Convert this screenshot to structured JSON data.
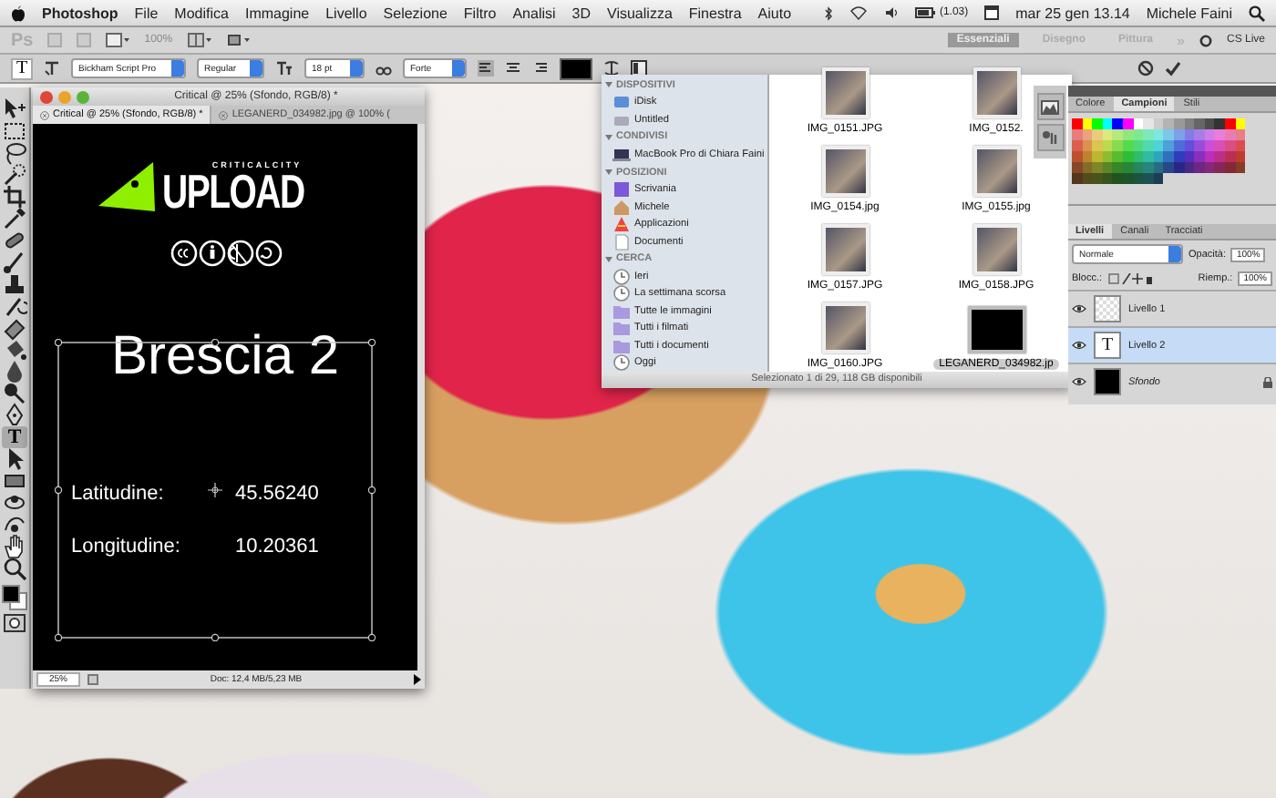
{
  "menubar": {
    "app": "Photoshop",
    "menus": [
      "File",
      "Modifica",
      "Immagine",
      "Livello",
      "Selezione",
      "Filtro",
      "Analisi",
      "3D",
      "Visualizza",
      "Finestra",
      "Aiuto"
    ],
    "battery": "(1.03)",
    "clock": "mar 25 gen 13.14",
    "user": "Michele Faini"
  },
  "app_bar": {
    "logo": "Ps",
    "zoom": "100%",
    "workspaces": [
      {
        "label": "Essenziali",
        "selected": true
      },
      {
        "label": "Disegno",
        "selected": false
      },
      {
        "label": "Pittura",
        "selected": false
      }
    ],
    "more": "»",
    "cs_live": "CS Live"
  },
  "options_bar": {
    "tool_glyph": "T",
    "font_family": "Bickham Script Pro",
    "font_style": "Regular",
    "font_size": "18 pt",
    "antialias": "Forte"
  },
  "tools": [
    {
      "kind": "move",
      "selected": false
    },
    {
      "kind": "marquee",
      "selected": false
    },
    {
      "kind": "lasso",
      "selected": false
    },
    {
      "kind": "quickselect",
      "selected": false
    },
    {
      "kind": "crop",
      "selected": false
    },
    {
      "kind": "eyedropper",
      "selected": false
    },
    {
      "kind": "heal",
      "selected": false
    },
    {
      "kind": "brush",
      "selected": false
    },
    {
      "kind": "stamp",
      "selected": false
    },
    {
      "kind": "history",
      "selected": false
    },
    {
      "kind": "eraser",
      "selected": false
    },
    {
      "kind": "bucket",
      "selected": false
    },
    {
      "kind": "blur",
      "selected": false
    },
    {
      "kind": "dodge",
      "selected": false
    },
    {
      "kind": "pen",
      "selected": false
    },
    {
      "kind": "type",
      "glyph": "T",
      "selected": true
    },
    {
      "kind": "pathselect",
      "selected": false
    },
    {
      "kind": "rectangle",
      "selected": false
    },
    {
      "kind": "rotate3d",
      "selected": false
    },
    {
      "kind": "orbit3d",
      "selected": false
    },
    {
      "kind": "hand",
      "selected": false
    },
    {
      "kind": "zoom",
      "selected": false
    }
  ],
  "document": {
    "title": "Critical @ 25% (Sfondo, RGB/8) *",
    "tabs": [
      {
        "label": "Critical @ 25% (Sfondo, RGB/8) *",
        "selected": true
      },
      {
        "label": "LEGANERD_034982.jpg @ 100% (",
        "selected": false
      }
    ],
    "canvas": {
      "logo_small": "CRITICALCITY",
      "logo_big": "UPLOAD",
      "heading": "Brescia 2",
      "fields": [
        {
          "label": "Latitudine:",
          "value": "45.56240"
        },
        {
          "label": "Longitudine:",
          "value": "10.20361"
        }
      ]
    },
    "zoom": "25%",
    "doc_info": "Doc: 12,4 MB/5,23 MB"
  },
  "finder": {
    "sections": [
      {
        "heading": "DISPOSITIVI",
        "items": [
          {
            "label": "iDisk",
            "kind": "disk"
          },
          {
            "label": "Untitled",
            "kind": "drive"
          }
        ]
      },
      {
        "heading": "CONDIVISI",
        "items": [
          {
            "label": "MacBook Pro di Chiara Faini",
            "kind": "computer"
          }
        ]
      },
      {
        "heading": "POSIZIONI",
        "items": [
          {
            "label": "Scrivania",
            "kind": "desktop"
          },
          {
            "label": "Michele",
            "kind": "home"
          },
          {
            "label": "Applicazioni",
            "kind": "apps"
          },
          {
            "label": "Documenti",
            "kind": "docs"
          }
        ]
      },
      {
        "heading": "CERCA",
        "items": [
          {
            "label": "Ieri",
            "kind": "clock"
          },
          {
            "label": "La settimana scorsa",
            "kind": "clock"
          },
          {
            "label": "Tutte le immagini",
            "kind": "folder"
          },
          {
            "label": "Tutti i filmati",
            "kind": "folder"
          },
          {
            "label": "Tutti i documenti",
            "kind": "folder"
          },
          {
            "label": "Oggi",
            "kind": "clock"
          }
        ]
      }
    ],
    "files": [
      {
        "name": "IMG_0151.JPG",
        "selected": false
      },
      {
        "name": "IMG_0152.",
        "selected": false
      },
      {
        "name": "IMG_0154.jpg",
        "selected": false
      },
      {
        "name": "IMG_0155.jpg",
        "selected": false
      },
      {
        "name": "IMG_0157.JPG",
        "selected": false
      },
      {
        "name": "IMG_0158.JPG",
        "selected": false
      },
      {
        "name": "IMG_0160.JPG",
        "selected": false
      },
      {
        "name": "LEGANERD_034982.jp",
        "selected": true
      }
    ],
    "status": "Selezionato 1 di 29, 118 GB disponibili"
  },
  "swatches_panel": {
    "tabs": [
      {
        "label": "Colore",
        "selected": false
      },
      {
        "label": "Campioni",
        "selected": true
      },
      {
        "label": "Stili",
        "selected": false
      }
    ]
  },
  "layers_panel": {
    "tabs": [
      {
        "label": "Livelli",
        "selected": true
      },
      {
        "label": "Canali",
        "selected": false
      },
      {
        "label": "Tracciati",
        "selected": false
      }
    ],
    "blend_mode": "Normale",
    "opacity_label": "Opacità:",
    "opacity": "100%",
    "lock_label": "Blocc.:",
    "fill_label": "Riemp.:",
    "fill": "100%",
    "layers": [
      {
        "name": "Livello 1",
        "kind": "image",
        "selected": false
      },
      {
        "name": "Livello 2",
        "kind": "text",
        "thumb_glyph": "T",
        "selected": true
      },
      {
        "name": "Sfondo",
        "kind": "background",
        "selected": false
      }
    ]
  }
}
